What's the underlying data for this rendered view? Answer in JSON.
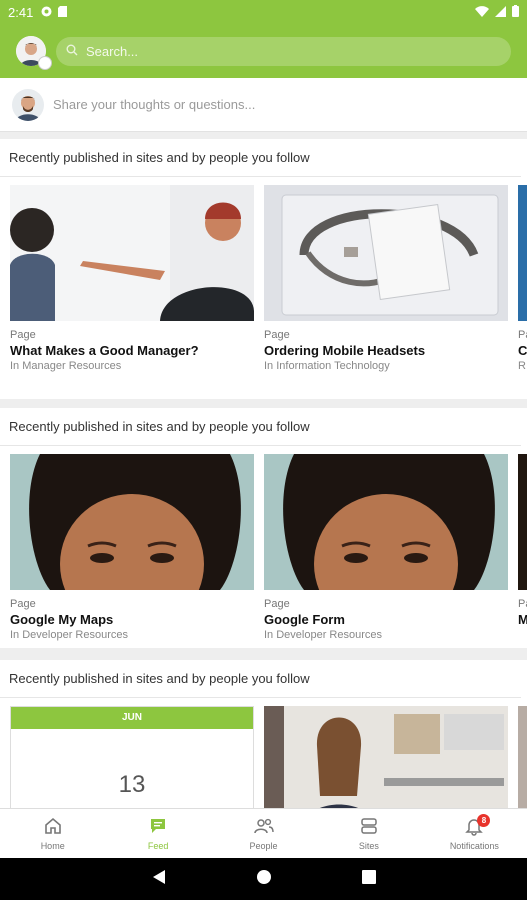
{
  "status_bar": {
    "time": "2:41"
  },
  "app_bar": {
    "search_placeholder": "Search..."
  },
  "composer": {
    "placeholder": "Share your thoughts or questions..."
  },
  "sections": [
    {
      "title": "Recently published in sites and by people you follow",
      "cards": [
        {
          "type": "Page",
          "title": "What Makes a Good Manager?",
          "site": "In Manager Resources"
        },
        {
          "type": "Page",
          "title": "Ordering Mobile Headsets",
          "site": "In Information Technology"
        },
        {
          "type": "Pa",
          "title": "C",
          "site": "R"
        }
      ]
    },
    {
      "title": "Recently published in sites and by people you follow",
      "cards": [
        {
          "type": "Page",
          "title": "Google My Maps",
          "site": "In Developer Resources"
        },
        {
          "type": "Page",
          "title": "Google Form",
          "site": "In Developer Resources"
        },
        {
          "type": "Pa",
          "title": "M",
          "site": ""
        }
      ]
    },
    {
      "title": "Recently published in sites and by people you follow",
      "calendar": {
        "month": "JUN",
        "day": "13"
      }
    }
  ],
  "bottom_nav": {
    "items": [
      {
        "label": "Home",
        "icon": "home-icon"
      },
      {
        "label": "Feed",
        "icon": "feed-icon"
      },
      {
        "label": "People",
        "icon": "people-icon"
      },
      {
        "label": "Sites",
        "icon": "sites-icon"
      },
      {
        "label": "Notifications",
        "icon": "bell-icon",
        "badge": "8"
      }
    ],
    "active": "Feed"
  },
  "colors": {
    "brand": "#8dc63f",
    "badge": "#e8332b"
  }
}
